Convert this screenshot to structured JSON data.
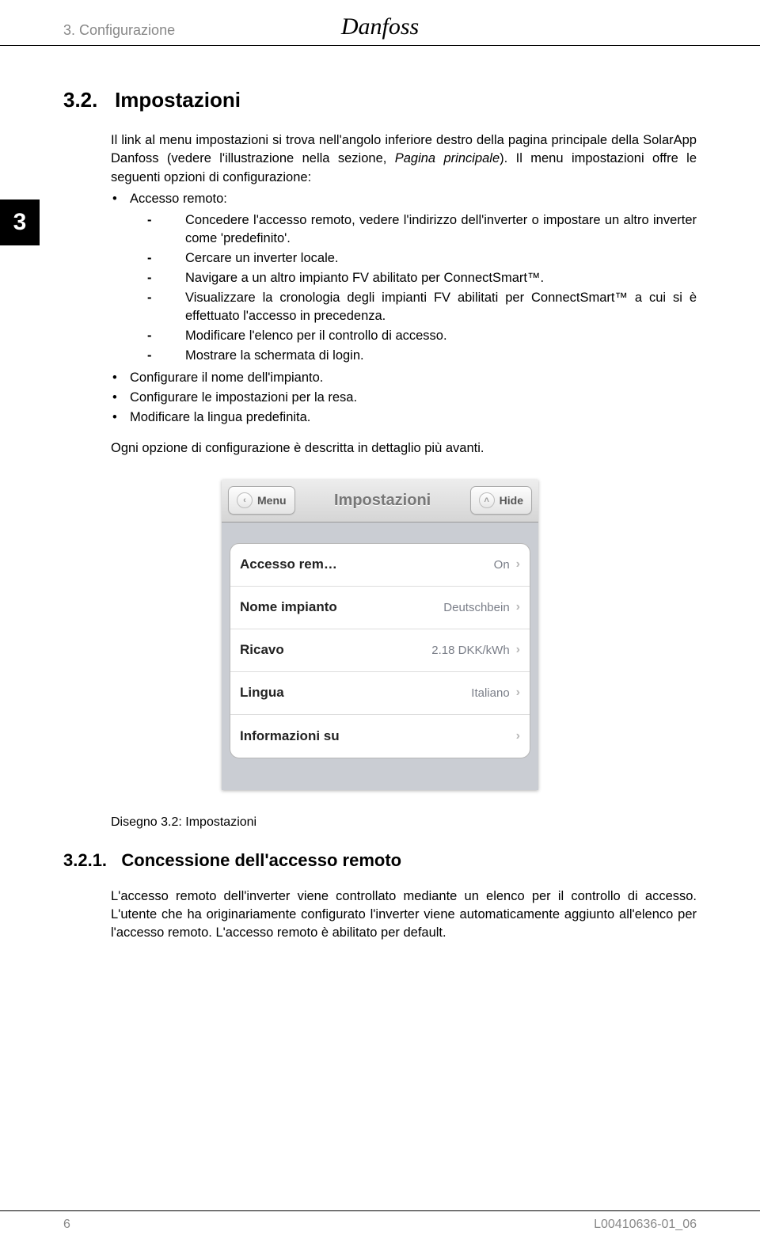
{
  "header": {
    "chapter": "3. Configurazione",
    "logo": "Danfoss"
  },
  "tab": "3",
  "section": {
    "number": "3.2.",
    "title": "Impostazioni",
    "intro_a": "Il link al menu impostazioni si trova nell'angolo inferiore destro della pagina principale della SolarApp Danfoss (vedere l'illustrazione nella sezione, ",
    "intro_italic": "Pagina principale",
    "intro_b": "). Il menu impostazioni offre le seguenti opzioni di configurazione:",
    "b1": "Accesso remoto:",
    "d1": "Concedere l'accesso remoto, vedere l'indirizzo dell'inverter o impostare un altro inverter come 'predefinito'.",
    "d2": "Cercare un inverter locale.",
    "d3": "Navigare a un altro impianto FV abilitato per ConnectSmart™.",
    "d4": "Visualizzare la cronologia degli impianti FV abilitati per ConnectSmart™ a cui si è effettuato l'accesso in precedenza.",
    "d5": "Modificare l'elenco per il controllo di accesso.",
    "d6": "Mostrare la schermata di login.",
    "b2": "Configurare il nome dell'impianto.",
    "b3": "Configurare le impostazioni per la resa.",
    "b4": "Modificare la lingua predefinita.",
    "outro": "Ogni opzione di configurazione è descritta in dettaglio più avanti.",
    "caption": "Disegno 3.2: Impostazioni"
  },
  "sub": {
    "number": "3.2.1.",
    "title": "Concessione dell'accesso remoto",
    "p": "L'accesso remoto dell'inverter viene controllato mediante un elenco per il controllo di accesso. L'utente che ha originariamente configurato l'inverter viene automaticamente aggiunto all'elenco per l'accesso remoto. L'accesso remoto è abilitato per default."
  },
  "ios": {
    "menu": "Menu",
    "title": "Impostazioni",
    "hide": "Hide",
    "rows": {
      "r1_label": "Accesso rem…",
      "r1_value": "On",
      "r2_label": "Nome impianto",
      "r2_value": "Deutschbein",
      "r3_label": "Ricavo",
      "r3_value": "2.18 DKK/kWh",
      "r4_label": "Lingua",
      "r4_value": "Italiano",
      "r5_label": "Informazioni su",
      "r5_value": ""
    }
  },
  "footer": {
    "page": "6",
    "code": "L00410636-01_06"
  }
}
